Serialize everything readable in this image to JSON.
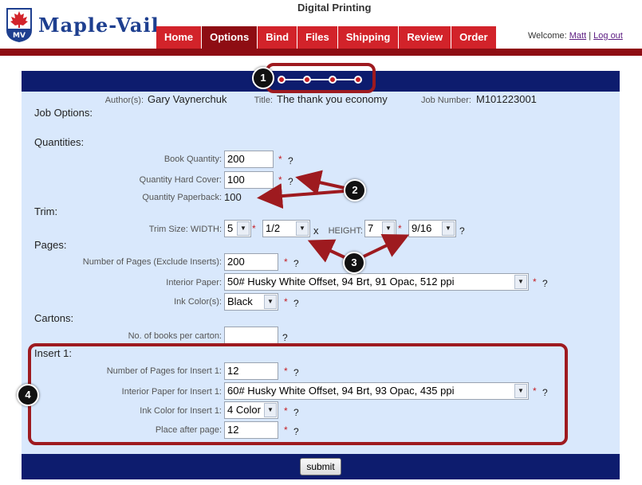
{
  "header": {
    "app_title": "Digital Printing",
    "logo_text": "Maple-Vail",
    "logo_badge": "MV",
    "nav": [
      {
        "label": "Home",
        "active": false
      },
      {
        "label": "Options",
        "active": true
      },
      {
        "label": "Bind",
        "active": false
      },
      {
        "label": "Files",
        "active": false
      },
      {
        "label": "Shipping",
        "active": false
      },
      {
        "label": "Review",
        "active": false
      },
      {
        "label": "Order",
        "active": false
      }
    ],
    "welcome_prefix": "Welcome:",
    "user_name": "Matt",
    "separator": "|",
    "logout": "Log out"
  },
  "job": {
    "author_label": "Author(s):",
    "author": "Gary Vaynerchuk",
    "title_label": "Title:",
    "title": "The thank you economy",
    "job_number_label": "Job Number:",
    "job_number": "M101223001"
  },
  "sections": {
    "job_options": "Job Options:",
    "quantities": "Quantities:",
    "trim": "Trim:",
    "pages": "Pages:",
    "cartons": "Cartons:",
    "insert": "Insert 1:"
  },
  "fields": {
    "book_quantity": {
      "label": "Book Quantity:",
      "value": "200"
    },
    "hard_cover": {
      "label": "Quantity Hard Cover:",
      "value": "100"
    },
    "paperback": {
      "label": "Quantity Paperback:",
      "value": "100"
    },
    "trim": {
      "label": "Trim Size: WIDTH:",
      "width_whole": "5",
      "width_frac": "1/2",
      "x": "x",
      "height_label": "HEIGHT:",
      "height_whole": "7",
      "height_frac": "9/16"
    },
    "num_pages": {
      "label": "Number of Pages (Exclude Inserts):",
      "value": "200"
    },
    "interior_paper": {
      "label": "Interior Paper:",
      "value": "50# Husky White Offset, 94 Brt, 91 Opac, 512 ppi"
    },
    "ink_color": {
      "label": "Ink Color(s):",
      "value": "Black"
    },
    "books_per_carton": {
      "label": "No. of books per carton:",
      "value": ""
    },
    "insert_pages": {
      "label": "Number of Pages for Insert 1:",
      "value": "12"
    },
    "insert_paper": {
      "label": "Interior Paper for Insert 1:",
      "value": "60# Husky White Offset, 94 Brt, 93 Opac, 435 ppi"
    },
    "insert_ink": {
      "label": "Ink Color for Insert 1:",
      "value": "4 Color"
    },
    "place_after": {
      "label": "Place after page:",
      "value": "12"
    }
  },
  "markers": {
    "required": "*",
    "help": "?"
  },
  "submit_label": "submit",
  "annotations": [
    "1",
    "2",
    "3",
    "4"
  ],
  "colors": {
    "nav_red": "#d2232a",
    "nav_active": "#8e0d13",
    "panel_bg": "#d9e8fc",
    "bar_navy": "#0d1c6e",
    "annotation": "#9e1a1f"
  }
}
